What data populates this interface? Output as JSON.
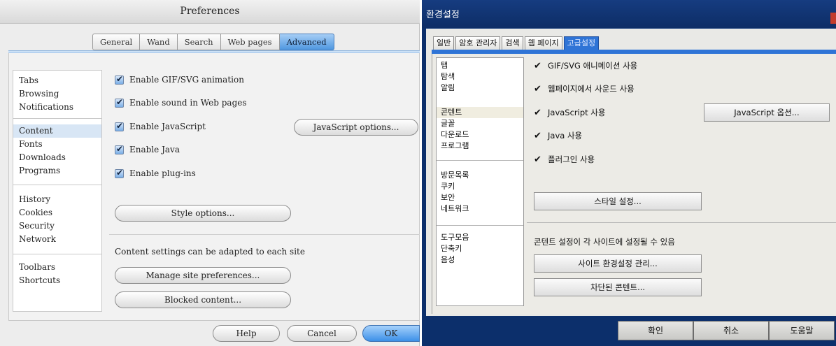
{
  "left": {
    "title": "Preferences",
    "tabs": [
      {
        "label": "General"
      },
      {
        "label": "Wand"
      },
      {
        "label": "Search"
      },
      {
        "label": "Web pages"
      },
      {
        "label": "Advanced"
      }
    ],
    "active_tab": "Advanced",
    "sidebar": {
      "items": [
        {
          "label": "Tabs"
        },
        {
          "label": "Browsing"
        },
        {
          "label": "Notifications"
        },
        {
          "label": "Content"
        },
        {
          "label": "Fonts"
        },
        {
          "label": "Downloads"
        },
        {
          "label": "Programs"
        },
        {
          "label": "History"
        },
        {
          "label": "Cookies"
        },
        {
          "label": "Security"
        },
        {
          "label": "Network"
        },
        {
          "label": "Toolbars"
        },
        {
          "label": "Shortcuts"
        }
      ],
      "selected": "Content"
    },
    "options": [
      {
        "label": "Enable GIF/SVG animation",
        "checked": true
      },
      {
        "label": "Enable sound in Web pages",
        "checked": true
      },
      {
        "label": "Enable JavaScript",
        "checked": true
      },
      {
        "label": "Enable Java",
        "checked": true
      },
      {
        "label": "Enable plug-ins",
        "checked": true
      }
    ],
    "javascript_options_label": "JavaScript options...",
    "style_options_label": "Style options...",
    "site_settings_text": "Content settings can be adapted to each site",
    "manage_site_label": "Manage site preferences...",
    "blocked_content_label": "Blocked content...",
    "footer": {
      "help": "Help",
      "cancel": "Cancel",
      "ok": "OK"
    }
  },
  "right": {
    "title": "환경설정",
    "tabs": [
      {
        "label": "일반"
      },
      {
        "label": "암호 관리자"
      },
      {
        "label": "검색"
      },
      {
        "label": "웹 페이지"
      },
      {
        "label": "고급설정"
      }
    ],
    "active_tab": "고급설정",
    "sidebar": {
      "items": [
        {
          "label": "탭"
        },
        {
          "label": "탐색"
        },
        {
          "label": "알림"
        },
        {
          "label": "콘텐트"
        },
        {
          "label": "글꼴"
        },
        {
          "label": "다운로드"
        },
        {
          "label": "프로그램"
        },
        {
          "label": "방문목록"
        },
        {
          "label": "쿠키"
        },
        {
          "label": "보안"
        },
        {
          "label": "네트워크"
        },
        {
          "label": "도구모음"
        },
        {
          "label": "단축키"
        },
        {
          "label": "음성"
        }
      ],
      "selected": "콘텐트"
    },
    "options": [
      {
        "label": "GIF/SVG 애니메이션 사용",
        "checked": true
      },
      {
        "label": "웹페이지에서 사운드 사용",
        "checked": true
      },
      {
        "label": "JavaScript 사용",
        "checked": true
      },
      {
        "label": "Java 사용",
        "checked": true
      },
      {
        "label": "플러그인 사용",
        "checked": true
      }
    ],
    "javascript_options_label": "JavaScript 옵션...",
    "style_options_label": "스타일 설정...",
    "site_settings_text": "콘텐트 설정이 각 사이트에 설정될 수 있음",
    "manage_site_label": "사이트 환경설정 관리...",
    "blocked_content_label": "차단된 콘텐트...",
    "footer": {
      "ok": "확인",
      "cancel": "취소",
      "help": "도움말"
    }
  }
}
